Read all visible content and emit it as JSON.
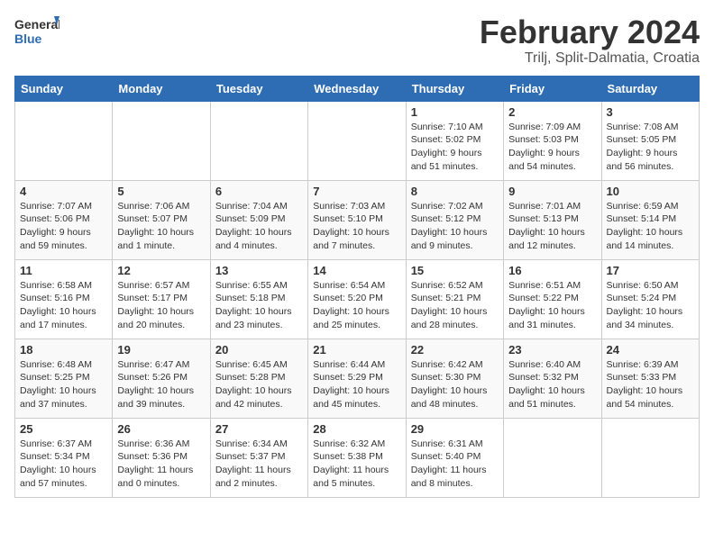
{
  "header": {
    "logo_general": "General",
    "logo_blue": "Blue",
    "month": "February 2024",
    "location": "Trilj, Split-Dalmatia, Croatia"
  },
  "weekdays": [
    "Sunday",
    "Monday",
    "Tuesday",
    "Wednesday",
    "Thursday",
    "Friday",
    "Saturday"
  ],
  "weeks": [
    [
      {
        "day": "",
        "detail": ""
      },
      {
        "day": "",
        "detail": ""
      },
      {
        "day": "",
        "detail": ""
      },
      {
        "day": "",
        "detail": ""
      },
      {
        "day": "1",
        "detail": "Sunrise: 7:10 AM\nSunset: 5:02 PM\nDaylight: 9 hours\nand 51 minutes."
      },
      {
        "day": "2",
        "detail": "Sunrise: 7:09 AM\nSunset: 5:03 PM\nDaylight: 9 hours\nand 54 minutes."
      },
      {
        "day": "3",
        "detail": "Sunrise: 7:08 AM\nSunset: 5:05 PM\nDaylight: 9 hours\nand 56 minutes."
      }
    ],
    [
      {
        "day": "4",
        "detail": "Sunrise: 7:07 AM\nSunset: 5:06 PM\nDaylight: 9 hours\nand 59 minutes."
      },
      {
        "day": "5",
        "detail": "Sunrise: 7:06 AM\nSunset: 5:07 PM\nDaylight: 10 hours\nand 1 minute."
      },
      {
        "day": "6",
        "detail": "Sunrise: 7:04 AM\nSunset: 5:09 PM\nDaylight: 10 hours\nand 4 minutes."
      },
      {
        "day": "7",
        "detail": "Sunrise: 7:03 AM\nSunset: 5:10 PM\nDaylight: 10 hours\nand 7 minutes."
      },
      {
        "day": "8",
        "detail": "Sunrise: 7:02 AM\nSunset: 5:12 PM\nDaylight: 10 hours\nand 9 minutes."
      },
      {
        "day": "9",
        "detail": "Sunrise: 7:01 AM\nSunset: 5:13 PM\nDaylight: 10 hours\nand 12 minutes."
      },
      {
        "day": "10",
        "detail": "Sunrise: 6:59 AM\nSunset: 5:14 PM\nDaylight: 10 hours\nand 14 minutes."
      }
    ],
    [
      {
        "day": "11",
        "detail": "Sunrise: 6:58 AM\nSunset: 5:16 PM\nDaylight: 10 hours\nand 17 minutes."
      },
      {
        "day": "12",
        "detail": "Sunrise: 6:57 AM\nSunset: 5:17 PM\nDaylight: 10 hours\nand 20 minutes."
      },
      {
        "day": "13",
        "detail": "Sunrise: 6:55 AM\nSunset: 5:18 PM\nDaylight: 10 hours\nand 23 minutes."
      },
      {
        "day": "14",
        "detail": "Sunrise: 6:54 AM\nSunset: 5:20 PM\nDaylight: 10 hours\nand 25 minutes."
      },
      {
        "day": "15",
        "detail": "Sunrise: 6:52 AM\nSunset: 5:21 PM\nDaylight: 10 hours\nand 28 minutes."
      },
      {
        "day": "16",
        "detail": "Sunrise: 6:51 AM\nSunset: 5:22 PM\nDaylight: 10 hours\nand 31 minutes."
      },
      {
        "day": "17",
        "detail": "Sunrise: 6:50 AM\nSunset: 5:24 PM\nDaylight: 10 hours\nand 34 minutes."
      }
    ],
    [
      {
        "day": "18",
        "detail": "Sunrise: 6:48 AM\nSunset: 5:25 PM\nDaylight: 10 hours\nand 37 minutes."
      },
      {
        "day": "19",
        "detail": "Sunrise: 6:47 AM\nSunset: 5:26 PM\nDaylight: 10 hours\nand 39 minutes."
      },
      {
        "day": "20",
        "detail": "Sunrise: 6:45 AM\nSunset: 5:28 PM\nDaylight: 10 hours\nand 42 minutes."
      },
      {
        "day": "21",
        "detail": "Sunrise: 6:44 AM\nSunset: 5:29 PM\nDaylight: 10 hours\nand 45 minutes."
      },
      {
        "day": "22",
        "detail": "Sunrise: 6:42 AM\nSunset: 5:30 PM\nDaylight: 10 hours\nand 48 minutes."
      },
      {
        "day": "23",
        "detail": "Sunrise: 6:40 AM\nSunset: 5:32 PM\nDaylight: 10 hours\nand 51 minutes."
      },
      {
        "day": "24",
        "detail": "Sunrise: 6:39 AM\nSunset: 5:33 PM\nDaylight: 10 hours\nand 54 minutes."
      }
    ],
    [
      {
        "day": "25",
        "detail": "Sunrise: 6:37 AM\nSunset: 5:34 PM\nDaylight: 10 hours\nand 57 minutes."
      },
      {
        "day": "26",
        "detail": "Sunrise: 6:36 AM\nSunset: 5:36 PM\nDaylight: 11 hours\nand 0 minutes."
      },
      {
        "day": "27",
        "detail": "Sunrise: 6:34 AM\nSunset: 5:37 PM\nDaylight: 11 hours\nand 2 minutes."
      },
      {
        "day": "28",
        "detail": "Sunrise: 6:32 AM\nSunset: 5:38 PM\nDaylight: 11 hours\nand 5 minutes."
      },
      {
        "day": "29",
        "detail": "Sunrise: 6:31 AM\nSunset: 5:40 PM\nDaylight: 11 hours\nand 8 minutes."
      },
      {
        "day": "",
        "detail": ""
      },
      {
        "day": "",
        "detail": ""
      }
    ]
  ]
}
